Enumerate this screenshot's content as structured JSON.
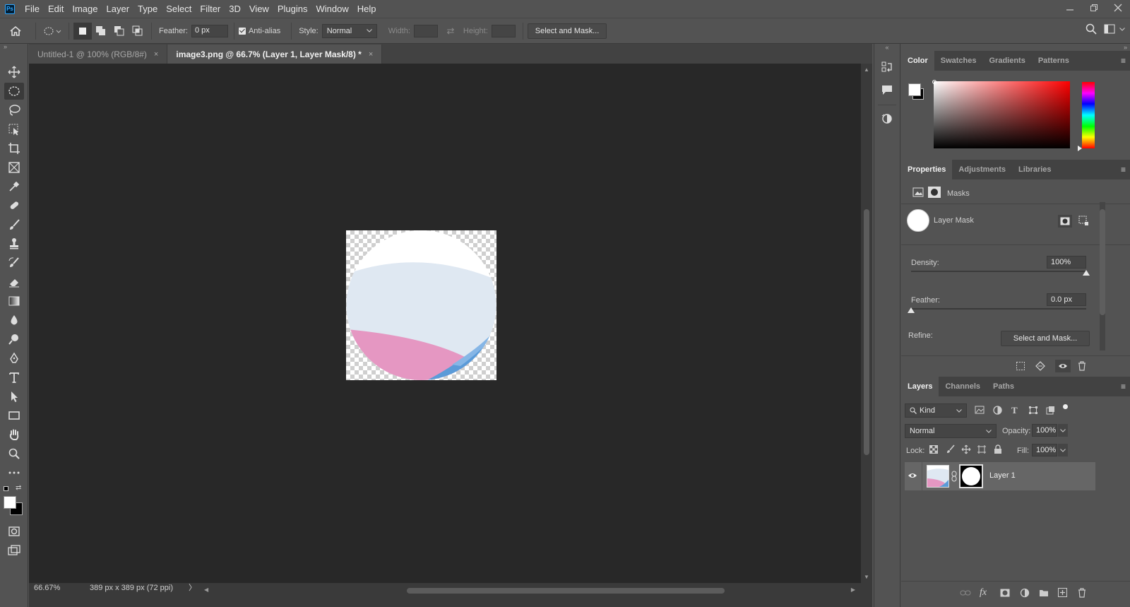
{
  "app": {
    "logo": "Ps"
  },
  "menu": [
    "File",
    "Edit",
    "Image",
    "Layer",
    "Type",
    "Select",
    "Filter",
    "3D",
    "View",
    "Plugins",
    "Window",
    "Help"
  ],
  "options": {
    "feather_label": "Feather:",
    "feather_value": "0 px",
    "antialias_label": "Anti-alias",
    "style_label": "Style:",
    "style_value": "Normal",
    "width_label": "Width:",
    "height_label": "Height:",
    "select_mask_button": "Select and Mask..."
  },
  "tabs": [
    {
      "label": "Untitled-1 @ 100% (RGB/8#)",
      "close": "×"
    },
    {
      "label": "image3.png @ 66.7% (Layer 1, Layer Mask/8) *",
      "close": "×"
    }
  ],
  "status": {
    "zoom": "66.67%",
    "doc_info": "389 px x 389 px (72 ppi)",
    "arrow": "〉"
  },
  "color_panel": {
    "tabs": [
      "Color",
      "Swatches",
      "Gradients",
      "Patterns"
    ]
  },
  "properties_panel": {
    "tabs": [
      "Properties",
      "Adjustments",
      "Libraries"
    ],
    "masks_label": "Masks",
    "layer_mask_label": "Layer Mask",
    "density_label": "Density:",
    "density_value": "100%",
    "feather_label": "Feather:",
    "feather_value": "0.0 px",
    "refine_label": "Refine:",
    "select_mask_button": "Select and Mask...",
    "density_level": 1.0,
    "feather_level": 0.0
  },
  "layers_panel": {
    "tabs": [
      "Layers",
      "Channels",
      "Paths"
    ],
    "kind_label": "Kind",
    "blend_mode": "Normal",
    "opacity_label": "Opacity:",
    "opacity_value": "100%",
    "lock_label": "Lock:",
    "fill_label": "Fill:",
    "fill_value": "100%",
    "layers": [
      {
        "name": "Layer 1"
      }
    ]
  },
  "colors": {
    "accent_blue": "#31a8ff",
    "pink": "#e597c2",
    "light_blue": "#dfe8f2",
    "blue": "#5b9bd8"
  }
}
